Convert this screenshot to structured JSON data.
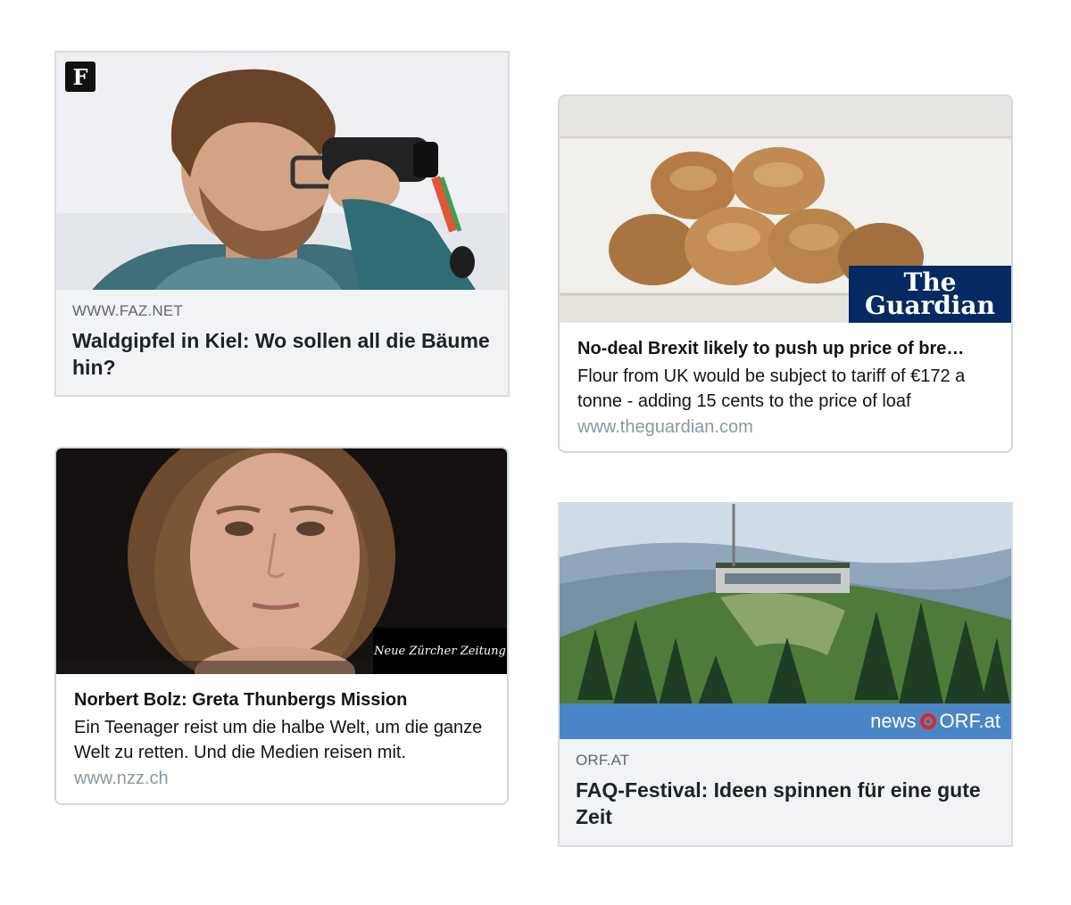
{
  "cards": [
    {
      "style": "facebook",
      "domain": "WWW.FAZ.NET",
      "title": "Waldgipfel in Kiel: Wo sollen all die Bäume hin?",
      "logo": "F",
      "logo_icon": "faz-logo-icon"
    },
    {
      "style": "twitter",
      "title": "No-deal Brexit likely to push up price of bre…",
      "description": "Flour from UK would be subject to tariff of €172 a tonne - adding 15 cents to the price of loaf",
      "domain": "www.theguardian.com",
      "logo_lines": [
        "The",
        "Guardian"
      ],
      "logo_bg": "#052962"
    },
    {
      "style": "twitter",
      "title": "Norbert Bolz: Greta Thunbergs Mission",
      "description": "Ein Teenager reist um die halbe Welt, um die ganze Welt zu retten. Und die Medien reisen mit.",
      "domain": "www.nzz.ch",
      "logo": "Neue Zürcher Zeitung"
    },
    {
      "style": "facebook",
      "domain": "ORF.AT",
      "title": "FAQ-Festival: Ideen spinnen für eine gute Zeit",
      "logo_news": "news",
      "logo_orf": "ORF.at",
      "logo_bg": "#4a86c5"
    }
  ]
}
